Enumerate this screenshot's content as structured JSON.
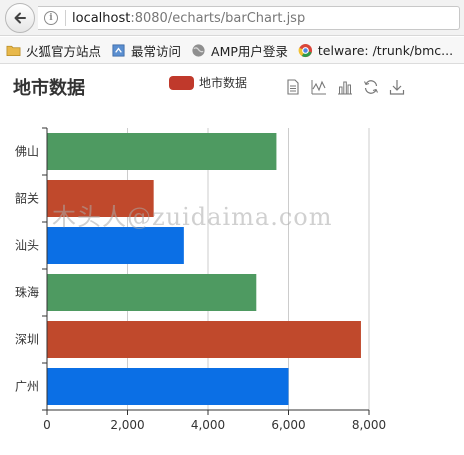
{
  "browser": {
    "url_host": "localhost",
    "url_path": ":8080/echarts/barChart.jsp",
    "bookmarks": [
      {
        "label": "火狐官方站点",
        "icon": "folder-icon"
      },
      {
        "label": "最常访问",
        "icon": "bookmark-page-icon"
      },
      {
        "label": "AMP用户登录",
        "icon": "globe-icon"
      },
      {
        "label": "telware: /trunk/bmc...",
        "icon": "chrome-icon"
      },
      {
        "label": "",
        "icon": "globe-icon"
      }
    ]
  },
  "chart": {
    "title": "地市数据",
    "legend_label": "地市数据",
    "toolbox": [
      "data-view-icon",
      "line-chart-icon",
      "bar-chart-icon",
      "refresh-icon",
      "download-icon"
    ]
  },
  "chart_data": {
    "type": "bar",
    "orientation": "horizontal",
    "title": "地市数据",
    "categories": [
      "广州",
      "深圳",
      "珠海",
      "汕头",
      "韶关",
      "佛山"
    ],
    "series": [
      {
        "name": "地市数据",
        "values": [
          6000,
          7800,
          5200,
          3400,
          2650,
          5700
        ]
      }
    ],
    "bar_colors": [
      "#0b6fe5",
      "#c0492c",
      "#4e9a61",
      "#0b6fe5",
      "#c0492c",
      "#4e9a61"
    ],
    "xlim": [
      0,
      8000
    ],
    "xticks": [
      "0",
      "2,000",
      "4,000",
      "6,000",
      "8,000"
    ],
    "grid": true
  },
  "watermark": "木头人@zuidaima.com"
}
